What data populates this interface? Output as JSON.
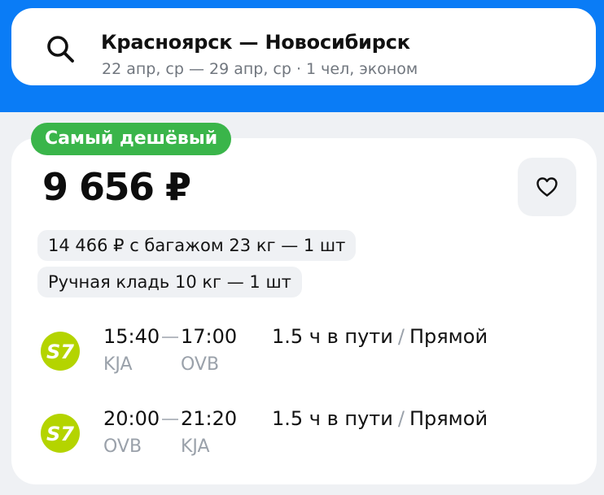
{
  "search": {
    "route": "Красноярск — Новосибирск",
    "details": "22 апр, ср — 29 апр, ср · 1 чел, эконом"
  },
  "offer": {
    "badge": "Самый дешёвый",
    "price": "9 656 ₽",
    "baggage_option": "14 466 ₽ с багажом 23 кг — 1 шт",
    "hand_luggage": "Ручная кладь 10 кг — 1 шт",
    "legs": [
      {
        "airline_logo": "S7",
        "departure_time": "15:40",
        "arrival_time": "17:00",
        "departure_code": "KJA",
        "arrival_code": "OVB",
        "duration": "1.5 ч в пути",
        "separator": "/",
        "stops": "Прямой"
      },
      {
        "airline_logo": "S7",
        "departure_time": "20:00",
        "arrival_time": "21:20",
        "departure_code": "OVB",
        "arrival_code": "KJA",
        "duration": "1.5 ч в пути",
        "separator": "/",
        "stops": "Прямой"
      }
    ]
  },
  "icons": {
    "search": "search-icon",
    "favorite": "heart-icon",
    "airline": "s7-logo"
  },
  "colors": {
    "header_bg": "#0a7cf6",
    "badge_bg": "#3ab54a",
    "airline_logo_bg": "#b4d400",
    "page_bg": "#eff1f4"
  }
}
